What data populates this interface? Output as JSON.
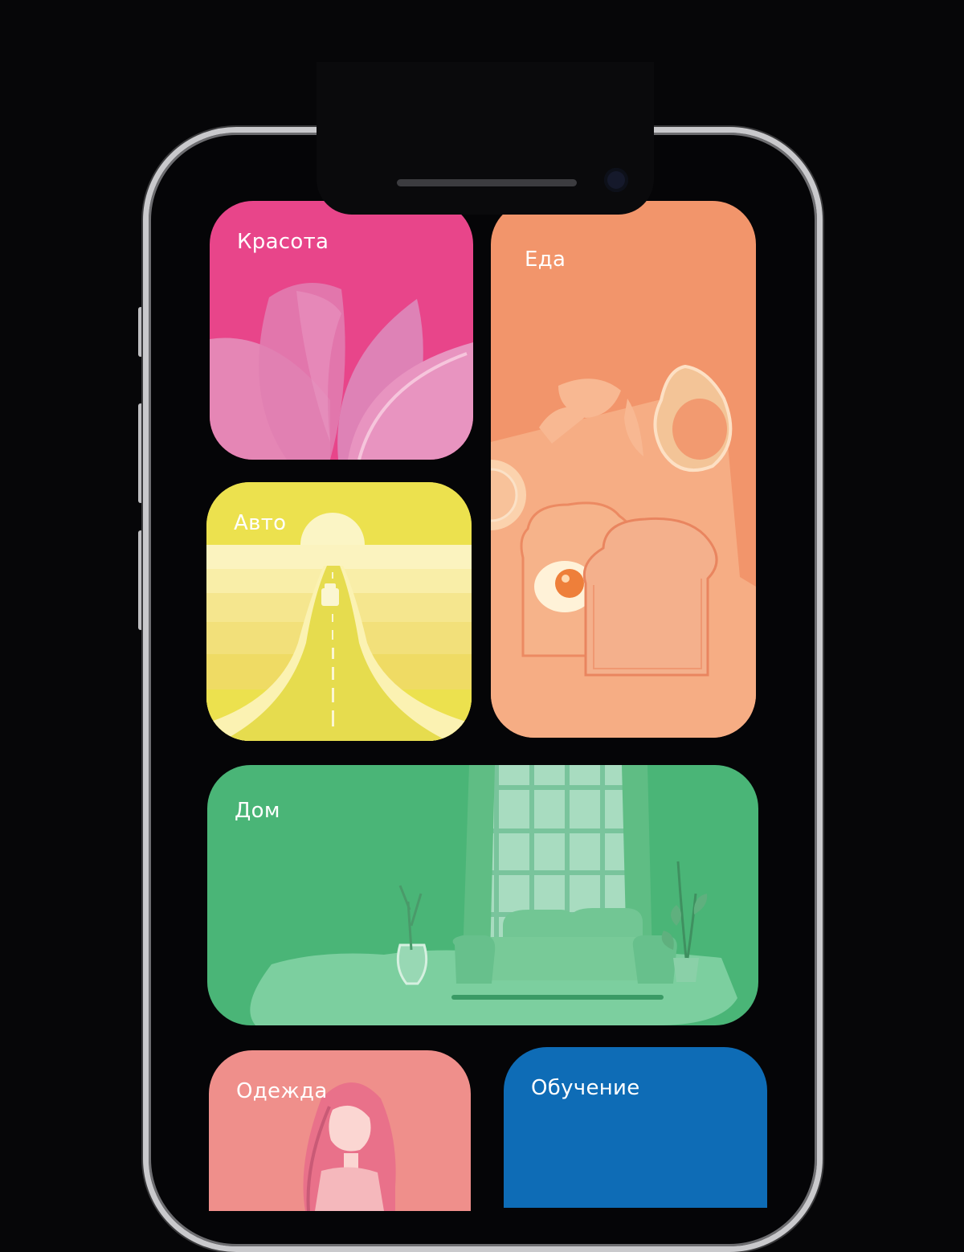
{
  "categories": {
    "beauty": {
      "label": "Красота",
      "icon": "lotus-icon",
      "color": "#e8458a"
    },
    "food": {
      "label": "Еда",
      "icon": "breakfast-icon",
      "color": "#f2956b"
    },
    "auto": {
      "label": "Авто",
      "icon": "road-icon",
      "color": "#ece14e"
    },
    "home": {
      "label": "Дом",
      "icon": "living-room-icon",
      "color": "#4ab577"
    },
    "clothes": {
      "label": "Одежда",
      "icon": "woman-portrait-icon",
      "color": "#ef8f8b"
    },
    "learning": {
      "label": "Обучение",
      "icon": "book-icon",
      "color": "#0e6cb6"
    }
  }
}
